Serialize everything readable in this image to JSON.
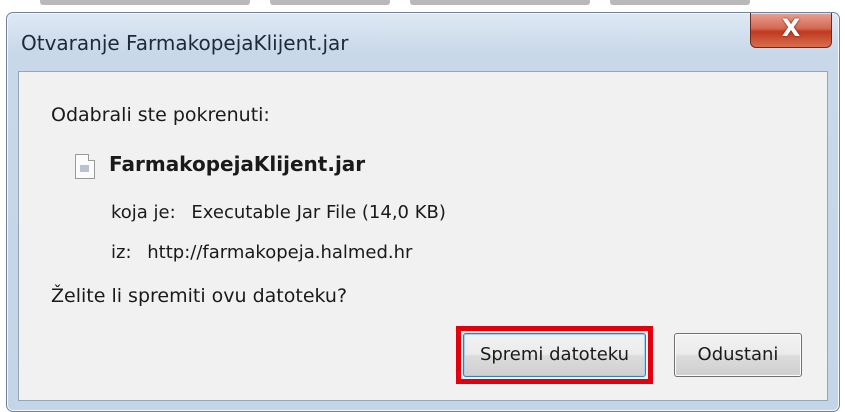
{
  "dialog": {
    "title": "Otvaranje FarmakopejaKlijent.jar",
    "close_label": "X",
    "prompt": "Odabrali ste pokrenuti:",
    "file_name": "FarmakopejaKlijent.jar",
    "file_icon": "jar-file-icon",
    "type_label": "koja je:",
    "type_value": "Executable Jar File (14,0 KB)",
    "from_label": "iz:",
    "from_value": "http://farmakopeja.halmed.hr",
    "question": "Želite li spremiti ovu datoteku?"
  },
  "buttons": {
    "save_label": "Spremi datoteku",
    "cancel_label": "Odustani"
  },
  "colors": {
    "highlight": "#e0000e",
    "close_button": "#c74a35",
    "titlebar": "#c8d8e9"
  }
}
